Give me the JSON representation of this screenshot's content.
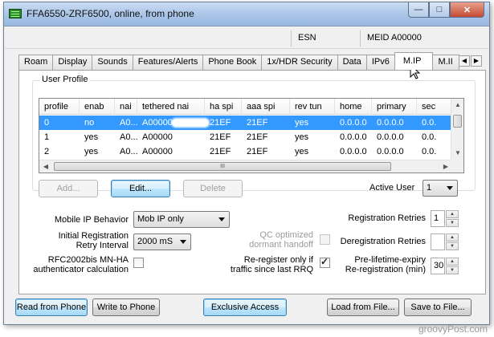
{
  "window": {
    "title": "FFA6550-ZRF6500, online, from phone",
    "min_label": "—",
    "max_label": "□",
    "close_label": "✕"
  },
  "info": {
    "esn_label": "ESN",
    "meid_label": "MEID A00000"
  },
  "tabs": [
    {
      "label": "Roam"
    },
    {
      "label": "Display"
    },
    {
      "label": "Sounds"
    },
    {
      "label": "Features/Alerts"
    },
    {
      "label": "Phone Book"
    },
    {
      "label": "1x/HDR Security"
    },
    {
      "label": "Data"
    },
    {
      "label": "IPv6"
    },
    {
      "label": "M.IP"
    },
    {
      "label": "M.II"
    }
  ],
  "tab_scroll": {
    "left": "◀",
    "right": "▶"
  },
  "user_profile": {
    "group_label": "User Profile",
    "columns": [
      "profile",
      "enab",
      "nai",
      "tethered nai",
      "ha spi",
      "aaa spi",
      "rev tun",
      "home",
      "primary",
      "sec"
    ],
    "rows": [
      [
        "0",
        "no",
        "A0...",
        "A00000",
        "21EF",
        "21EF",
        "yes",
        "0.0.0.0",
        "0.0.0.0",
        "0.0."
      ],
      [
        "1",
        "yes",
        "A0...",
        "A00000",
        "21EF",
        "21EF",
        "yes",
        "0.0.0.0",
        "0.0.0.0",
        "0.0."
      ],
      [
        "2",
        "yes",
        "A0...",
        "A00000",
        "21EF",
        "21EF",
        "yes",
        "0.0.0.0",
        "0.0.0.0",
        "0.0."
      ]
    ],
    "selected_row": 0,
    "hscroll_grip": "III",
    "add_label": "Add...",
    "edit_label": "Edit...",
    "delete_label": "Delete",
    "active_user_label": "Active User",
    "active_user_value": "1"
  },
  "settings": {
    "mip_behavior_label": "Mobile IP Behavior",
    "mip_behavior_value": "Mob IP only",
    "init_reg_label_1": "Initial Registration",
    "init_reg_label_2": "Retry Interval",
    "init_reg_value": "2000 mS",
    "rfc_label_1": "RFC2002bis MN-HA",
    "rfc_label_2": "authenticator calculation",
    "rfc_checked": false,
    "qc_label_1": "QC optimized",
    "qc_label_2": "dormant handoff",
    "qc_checked": false,
    "rereg_label_1": "Re-register only if",
    "rereg_label_2": "traffic since last RRQ",
    "rereg_checked": true,
    "reg_retries_label": "Registration Retries",
    "reg_retries_value": "1",
    "dereg_retries_label": "Deregistration Retries",
    "dereg_retries_value": "",
    "prelife_label_1": "Pre-lifetime-expiry",
    "prelife_label_2": "Re-registration (min)",
    "prelife_value": "30"
  },
  "bottom": {
    "read_label": "Read from Phone",
    "write_label": "Write to Phone",
    "exclusive_label": "Exclusive Access",
    "load_label": "Load from File...",
    "save_label": "Save to File..."
  },
  "watermark": "groovyPost.com",
  "colors": {
    "selection": "#3399ff",
    "titlebar": "#a6c2e6",
    "close": "#c44a32"
  }
}
